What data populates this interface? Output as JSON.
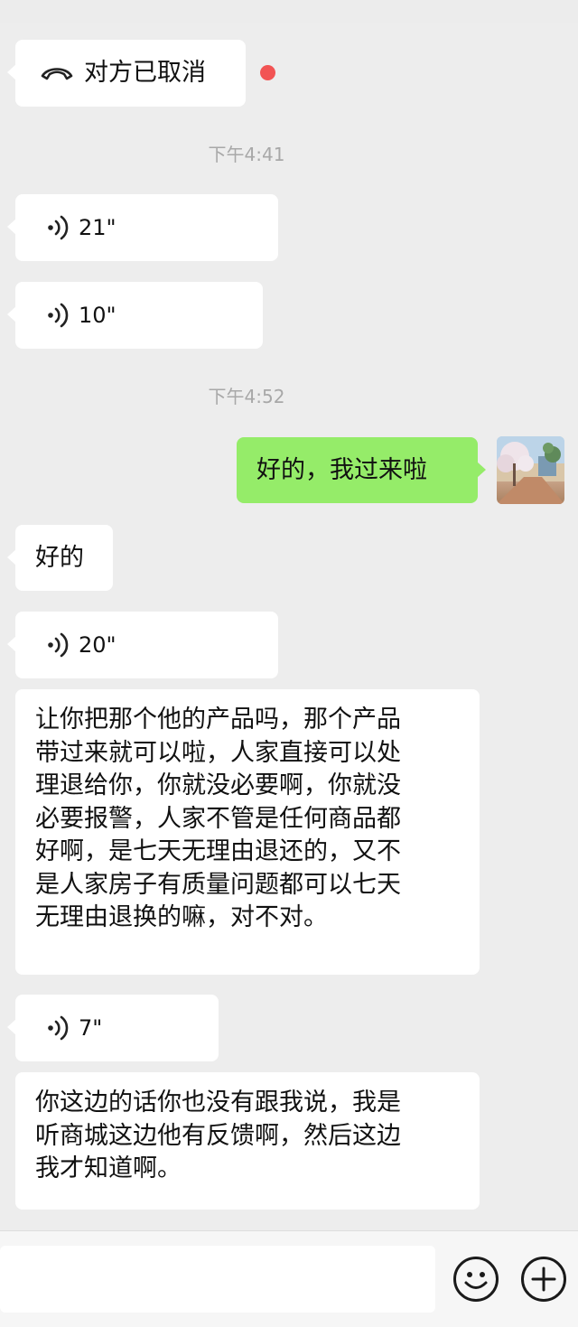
{
  "messages": {
    "call_cancelled": {
      "text": "对方已取消",
      "unread_indicator_color": "#f25454"
    },
    "time_1": "下午4:41",
    "voice_1": {
      "duration": "21\""
    },
    "voice_2": {
      "duration": "10\""
    },
    "time_2": "下午4:52",
    "outgoing_1": "好的，我过来啦",
    "incoming_1": "好的",
    "voice_3": {
      "duration": "20\""
    },
    "incoming_long_1": [
      "让你把那个他的产品吗，那个产品",
      "带过来就可以啦，人家直接可以处",
      "理退给你，你就没必要啊，你就没",
      "必要报警，人家不管是任何商品都",
      "好啊，是七天无理由退还的，又不",
      "是人家房子有质量问题都可以七天",
      "无理由退换的嘛，对不对。"
    ],
    "voice_4": {
      "duration": "7\""
    },
    "incoming_long_2": [
      "你这边的话你也没有跟我说，我是",
      "听商城这边他有反馈啊，然后这边",
      "我才知道啊。"
    ]
  },
  "composer": {
    "emoji_icon": "emoji-icon",
    "plus_icon": "plus-icon"
  },
  "colors": {
    "background": "#ededed",
    "incoming_bubble": "#ffffff",
    "outgoing_bubble": "#95ec69",
    "timestamp": "#a8a8a8"
  }
}
